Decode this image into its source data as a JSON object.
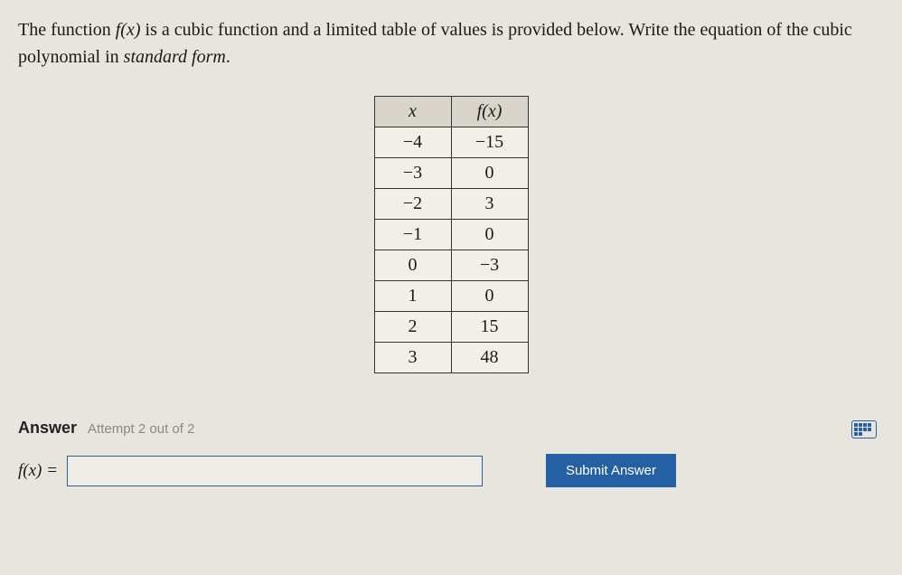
{
  "question": {
    "part1": "The function ",
    "fn": "f(x)",
    "part2": " is a cubic function and a limited table of values is provided below. Write the equation of the cubic polynomial in ",
    "italic_phrase": "standard form",
    "part3": "."
  },
  "chart_data": {
    "type": "table",
    "headers": {
      "x": "x",
      "fx": "f(x)"
    },
    "rows": [
      {
        "x": "−4",
        "fx": "−15"
      },
      {
        "x": "−3",
        "fx": "0"
      },
      {
        "x": "−2",
        "fx": "3"
      },
      {
        "x": "−1",
        "fx": "0"
      },
      {
        "x": "0",
        "fx": "−3"
      },
      {
        "x": "1",
        "fx": "0"
      },
      {
        "x": "2",
        "fx": "15"
      },
      {
        "x": "3",
        "fx": "48"
      }
    ]
  },
  "answer": {
    "label": "Answer",
    "attempt": "Attempt 2 out of 2",
    "fx_prefix": "f(x) =",
    "input_value": "",
    "input_placeholder": "",
    "submit": "Submit Answer"
  }
}
